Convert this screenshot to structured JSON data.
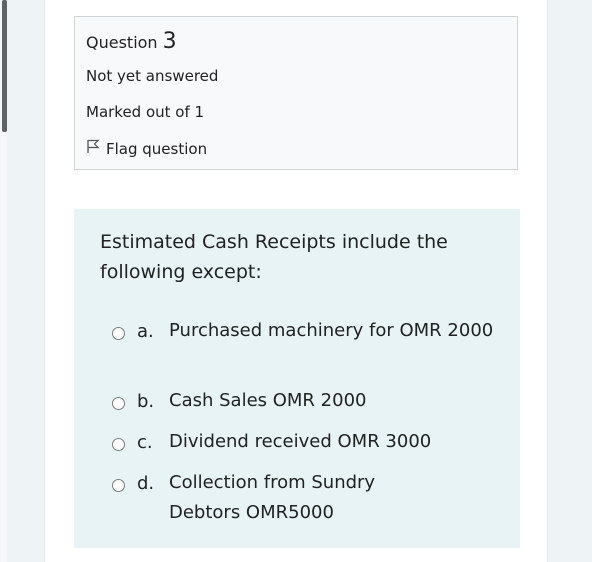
{
  "question_info": {
    "label": "Question",
    "number": "3",
    "status": "Not yet answered",
    "marks": "Marked out of 1",
    "flag_label": "Flag question"
  },
  "question": {
    "text": "Estimated Cash Receipts include the following except:",
    "options": [
      {
        "letter": "a.",
        "text": "Purchased machinery for OMR 2000"
      },
      {
        "letter": "b.",
        "text": "Cash Sales OMR 2000"
      },
      {
        "letter": "c.",
        "text": "Dividend received OMR 3000"
      },
      {
        "letter": "d.",
        "text": "Collection from Sundry Debtors OMR5000"
      }
    ]
  },
  "colors": {
    "content_background": "#e7f3f5",
    "info_background": "#f8f9fa",
    "page_background": "#eef3f6"
  },
  "icons": {
    "flag": "flag-icon",
    "radio": "radio-unselected"
  }
}
